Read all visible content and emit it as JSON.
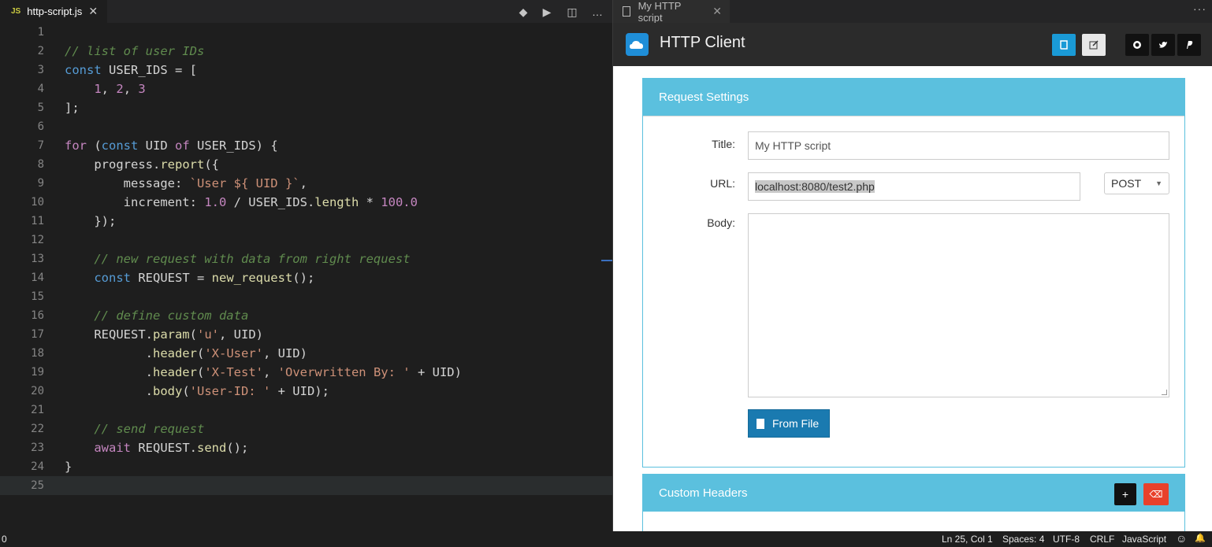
{
  "editor": {
    "tab_badge": "JS",
    "tab_filename": "http-script.js",
    "tab_close": "✕",
    "toolbar": {
      "git_icon": "◆",
      "run_icon": "▶",
      "split_icon": "◫",
      "more_icon": "…"
    },
    "line_numbers": [
      "1",
      "2",
      "3",
      "4",
      "5",
      "6",
      "7",
      "8",
      "9",
      "10",
      "11",
      "12",
      "13",
      "14",
      "15",
      "16",
      "17",
      "18",
      "19",
      "20",
      "21",
      "22",
      "23",
      "24",
      "25"
    ],
    "lines": [
      [],
      [
        [
          "c",
          "// list of user IDs"
        ]
      ],
      [
        [
          "kd",
          "const"
        ],
        [
          "op",
          " USER_IDS = ["
        ]
      ],
      [
        [
          "op",
          "    "
        ],
        [
          "kw",
          "1"
        ],
        [
          "op",
          ", "
        ],
        [
          "kw",
          "2"
        ],
        [
          "op",
          ", "
        ],
        [
          "kw",
          "3"
        ]
      ],
      [
        [
          "op",
          "];"
        ]
      ],
      [],
      [
        [
          "kw",
          "for"
        ],
        [
          "op",
          " ("
        ],
        [
          "kd",
          "const"
        ],
        [
          "op",
          " UID "
        ],
        [
          "kw",
          "of"
        ],
        [
          "op",
          " USER_IDS) {"
        ]
      ],
      [
        [
          "op",
          "    progress."
        ],
        [
          "fn",
          "report"
        ],
        [
          "op",
          "({"
        ]
      ],
      [
        [
          "op",
          "        message: "
        ],
        [
          "str",
          "`User ${ UID }`"
        ],
        [
          "op",
          ","
        ]
      ],
      [
        [
          "op",
          "        increment: "
        ],
        [
          "kw",
          "1.0"
        ],
        [
          "op",
          " / USER_IDS."
        ],
        [
          "fn",
          "length"
        ],
        [
          "op",
          " * "
        ],
        [
          "kw",
          "100.0"
        ]
      ],
      [
        [
          "op",
          "    });"
        ]
      ],
      [],
      [
        [
          "op",
          "    "
        ],
        [
          "c",
          "// new request with data from right request"
        ]
      ],
      [
        [
          "op",
          "    "
        ],
        [
          "kd",
          "const"
        ],
        [
          "op",
          " REQUEST = "
        ],
        [
          "fn",
          "new_request"
        ],
        [
          "op",
          "();"
        ]
      ],
      [],
      [
        [
          "op",
          "    "
        ],
        [
          "c",
          "// define custom data"
        ]
      ],
      [
        [
          "op",
          "    REQUEST."
        ],
        [
          "fn",
          "param"
        ],
        [
          "op",
          "("
        ],
        [
          "str",
          "'u'"
        ],
        [
          "op",
          ", UID)"
        ]
      ],
      [
        [
          "op",
          "           ."
        ],
        [
          "fn",
          "header"
        ],
        [
          "op",
          "("
        ],
        [
          "str",
          "'X-User'"
        ],
        [
          "op",
          ", UID)"
        ]
      ],
      [
        [
          "op",
          "           ."
        ],
        [
          "fn",
          "header"
        ],
        [
          "op",
          "("
        ],
        [
          "str",
          "'X-Test'"
        ],
        [
          "op",
          ", "
        ],
        [
          "str",
          "'Overwritten By: '"
        ],
        [
          "op",
          " + UID)"
        ]
      ],
      [
        [
          "op",
          "           ."
        ],
        [
          "fn",
          "body"
        ],
        [
          "op",
          "("
        ],
        [
          "str",
          "'User-ID: '"
        ],
        [
          "op",
          " + UID);"
        ]
      ],
      [],
      [
        [
          "op",
          "    "
        ],
        [
          "c",
          "// send request"
        ]
      ],
      [
        [
          "op",
          "    "
        ],
        [
          "kw",
          "await"
        ],
        [
          "op",
          " REQUEST."
        ],
        [
          "fn",
          "send"
        ],
        [
          "op",
          "();"
        ]
      ],
      [
        [
          "op",
          "}"
        ]
      ],
      []
    ]
  },
  "right": {
    "tab_title": "My HTTP script",
    "tab_close": "✕",
    "more_icon": "···",
    "app_title": "HTTP Client",
    "request_settings": {
      "heading": "Request Settings",
      "title_label": "Title:",
      "title_value": "My HTTP script",
      "url_label": "URL:",
      "url_value": "localhost:8080/test2.php",
      "method_value": "POST",
      "body_label": "Body:",
      "body_value": "",
      "from_file_label": "From File"
    },
    "custom_headers": {
      "heading": "Custom Headers",
      "add_icon": "+",
      "clear_icon": "⌫"
    }
  },
  "statusbar": {
    "left": "0",
    "position": "Ln 25, Col 1",
    "spaces": "Spaces: 4",
    "encoding": "UTF-8",
    "eol": "CRLF",
    "language": "JavaScript",
    "feedback_icon": "☺",
    "bell_icon": "🔔"
  }
}
